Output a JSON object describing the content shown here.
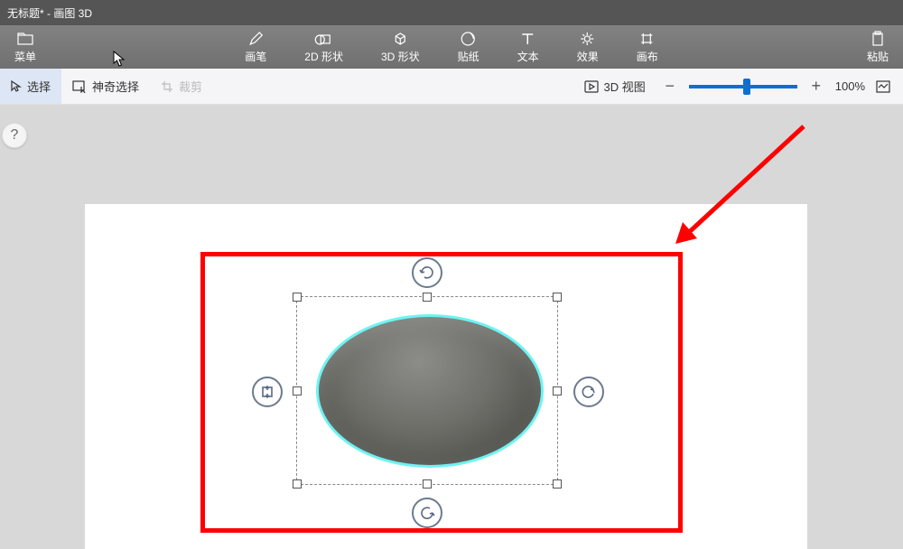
{
  "title_bar": {
    "title": "无标题* - 画图 3D"
  },
  "menu": {
    "left": {
      "label": "菜单"
    },
    "items": [
      {
        "label": "画笔"
      },
      {
        "label": "2D 形状"
      },
      {
        "label": "3D 形状"
      },
      {
        "label": "贴纸"
      },
      {
        "label": "文本"
      },
      {
        "label": "效果"
      },
      {
        "label": "画布"
      }
    ],
    "right": {
      "label": "粘贴"
    }
  },
  "toolbar": {
    "select": "选择",
    "magic": "神奇选择",
    "crop": "裁剪",
    "view3d": "3D 视图",
    "zoom": "100%"
  }
}
